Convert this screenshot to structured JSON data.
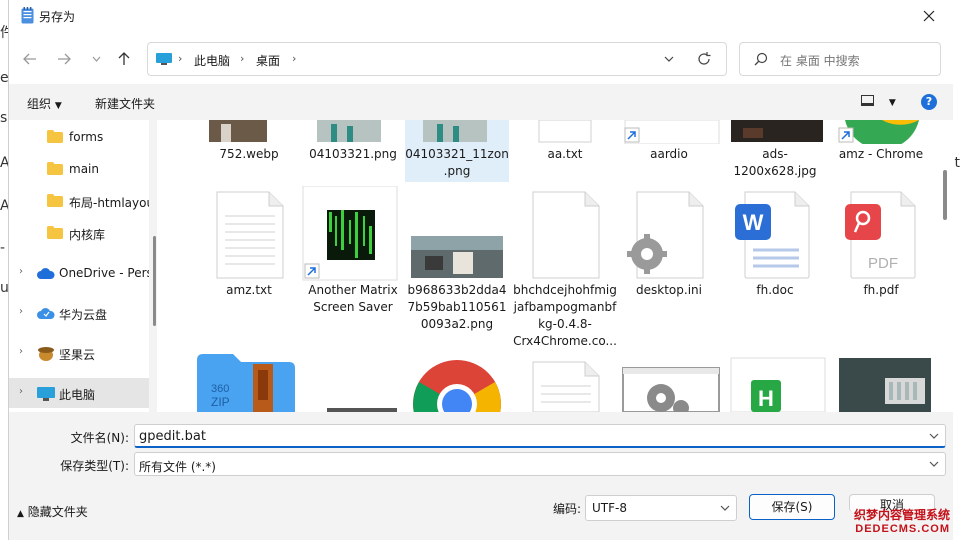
{
  "window": {
    "title": "另存为"
  },
  "nav": {
    "breadcrumbs": [
      "此电脑",
      "桌面"
    ],
    "search_placeholder": "在 桌面 中搜索"
  },
  "toolbar": {
    "organize": "组织",
    "new_folder": "新建文件夹"
  },
  "sidebar": {
    "items": [
      {
        "label": "forms",
        "icon": "folder-icon"
      },
      {
        "label": "main",
        "icon": "folder-icon"
      },
      {
        "label": "布局-htmlayou",
        "icon": "folder-icon"
      },
      {
        "label": "内核库",
        "icon": "folder-icon"
      },
      {
        "label": "OneDrive - Pers",
        "icon": "cloud-icon"
      },
      {
        "label": "华为云盘",
        "icon": "huawei-cloud-icon"
      },
      {
        "label": "坚果云",
        "icon": "nut-cloud-icon"
      },
      {
        "label": "此电脑",
        "icon": "pc-icon"
      }
    ]
  },
  "files": {
    "row1": [
      "752.webp",
      "04103321.png",
      "04103321_11zon.png",
      "aa.txt",
      "aardio",
      "ads-1200x628.jpg",
      "amz - Chrome"
    ],
    "row2": [
      "amz.txt",
      "Another Matrix Screen Saver",
      "b968633b2dda47b59bab1105610093a2.png",
      "bhchdcejhohfmigjafbampogmanbfkg-0.4.8-Crx4Chrome.co...",
      "desktop.ini",
      "fh.doc",
      "fh.pdf"
    ]
  },
  "form": {
    "filename_label": "文件名(N):",
    "filename_value": "gpedit.bat",
    "filetype_label": "保存类型(T):",
    "filetype_value": "所有文件 (*.*)"
  },
  "footer": {
    "hide_folders": "隐藏文件夹",
    "encoding_label": "编码:",
    "encoding_value": "UTF-8",
    "save": "保存(S)",
    "cancel": "取消"
  },
  "watermark": {
    "line1": "织梦内容管理系统",
    "line2": "DEDECMS.COM"
  },
  "colors": {
    "accent": "#0a62c9",
    "selected": "#e0eefa"
  }
}
